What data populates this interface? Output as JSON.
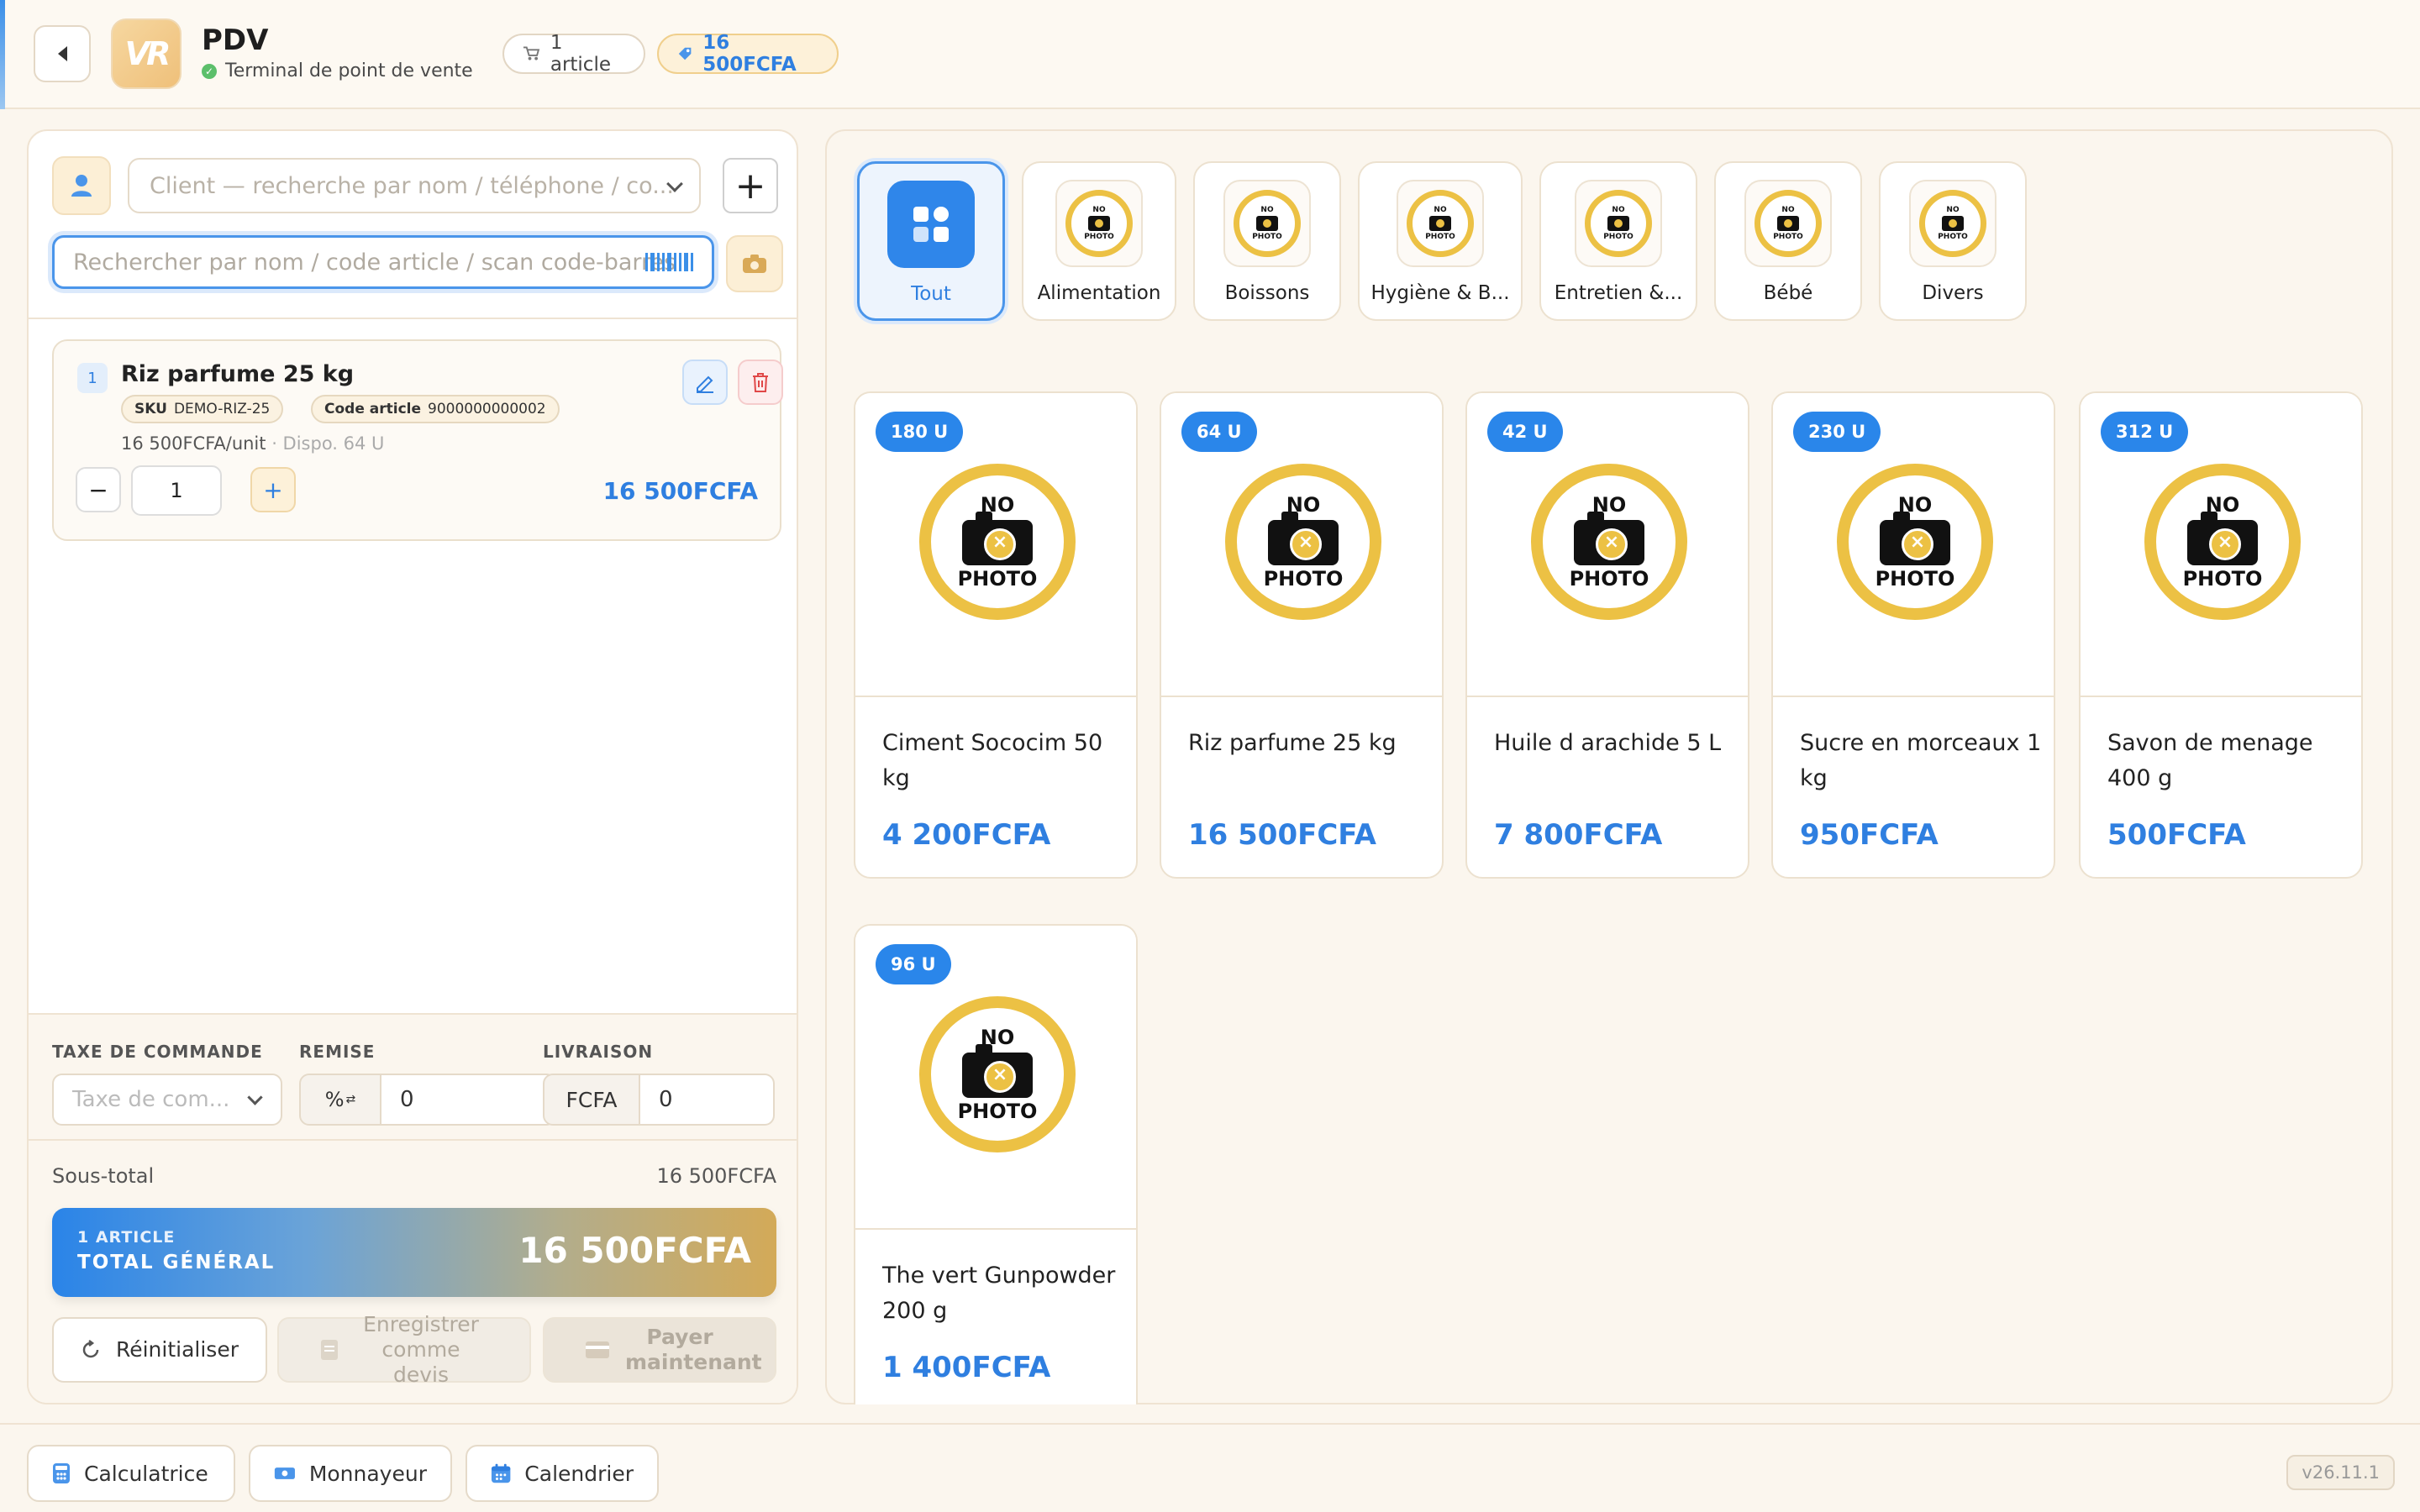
{
  "header": {
    "title": "PDV",
    "subtitle": "Terminal de point de vente",
    "logo_text": "VR",
    "articles_pill": "1 article",
    "total_pill": "16 500FCFA"
  },
  "client": {
    "placeholder": "Client — recherche par nom / téléphone / co...",
    "add_label": "+"
  },
  "search": {
    "placeholder": "Rechercher par nom / code article / scan code-barres"
  },
  "cart": {
    "items": [
      {
        "index": "1",
        "name": "Riz parfume 25 kg",
        "sku_label": "SKU",
        "sku": "DEMO-RIZ-25",
        "code_label": "Code article",
        "code": "9000000000002",
        "unit_price": "16 500FCFA/unit",
        "dispo": "· Dispo. 64 U",
        "quantity": "1",
        "total": "16 500FCFA"
      }
    ]
  },
  "order": {
    "tax_label": "TAXE DE COMMANDE",
    "tax_placeholder": "Taxe de com...",
    "remise_label": "REMISE",
    "remise_type": "%",
    "remise_value": "0",
    "livraison_label": "LIVRAISON",
    "livraison_currency": "FCFA",
    "livraison_value": "0"
  },
  "totals": {
    "subtotal_label": "Sous-total",
    "subtotal_value": "16 500FCFA",
    "count_label": "1 ARTICLE",
    "grand_label": "TOTAL GÉNÉRAL",
    "grand_value": "16 500FCFA"
  },
  "actions": {
    "reset": "Réinitialiser",
    "devis": "Enregistrer comme devis",
    "pay": "Payer maintenant"
  },
  "categories": [
    {
      "label": "Tout",
      "active": true
    },
    {
      "label": "Alimentation"
    },
    {
      "label": "Boissons"
    },
    {
      "label": "Hygiène & B..."
    },
    {
      "label": "Entretien &..."
    },
    {
      "label": "Bébé"
    },
    {
      "label": "Divers"
    }
  ],
  "nophoto": {
    "top": "NO",
    "bottom": "PHOTO"
  },
  "products": [
    {
      "stock": "180 U",
      "name": "Ciment Sococim 50 kg",
      "price": "4 200FCFA"
    },
    {
      "stock": "64 U",
      "name": "Riz parfume 25 kg",
      "price": "16 500FCFA"
    },
    {
      "stock": "42 U",
      "name": "Huile d arachide 5 L",
      "price": "7 800FCFA"
    },
    {
      "stock": "230 U",
      "name": "Sucre en morceaux 1 kg",
      "price": "950FCFA"
    },
    {
      "stock": "312 U",
      "name": "Savon de menage 400 g",
      "price": "500FCFA"
    },
    {
      "stock": "96 U",
      "name": "The vert Gunpowder 200 g",
      "price": "1 400FCFA"
    }
  ],
  "tools": {
    "calculator": "Calculatrice",
    "money": "Monnayeur",
    "calendar": "Calendrier",
    "version": "v26.11.1"
  },
  "colors": {
    "accent": "#2f7fe0",
    "gold": "#ecc144",
    "background": "#fbf6ee"
  }
}
